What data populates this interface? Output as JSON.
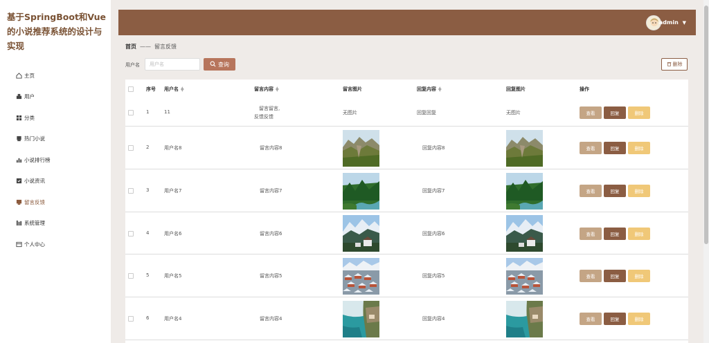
{
  "app": {
    "title": "基于SpringBoot和Vue的小说推荐系统的设计与实现"
  },
  "sidebar": {
    "items": [
      {
        "label": "主页",
        "icon": "home-icon"
      },
      {
        "label": "用户",
        "icon": "user-icon"
      },
      {
        "label": "分类",
        "icon": "grid-icon"
      },
      {
        "label": "热门小说",
        "icon": "book-icon"
      },
      {
        "label": "小说排行榜",
        "icon": "bar-chart-icon"
      },
      {
        "label": "小说资讯",
        "icon": "news-icon"
      },
      {
        "label": "留言反馈",
        "icon": "message-icon"
      },
      {
        "label": "系统管理",
        "icon": "settings-icon"
      },
      {
        "label": "个人中心",
        "icon": "profile-icon"
      }
    ]
  },
  "header": {
    "username": "admin"
  },
  "breadcrumb": {
    "home": "首页",
    "separator": "——",
    "current": "留言反馈"
  },
  "search": {
    "label": "用户名",
    "placeholder": "用户名",
    "button": "查询"
  },
  "toolbar": {
    "delete_label": "删除"
  },
  "table": {
    "columns": {
      "index": "序号",
      "username": "用户名",
      "content": "留言内容",
      "image": "留言图片",
      "reply": "回复内容",
      "reply_image": "回复图片",
      "actions": "操作"
    },
    "no_image": "无图片",
    "rows": [
      {
        "index": "1",
        "username": "11",
        "content": "留言留言,",
        "content2": "反馈反馈",
        "reply": "回复回复",
        "image": "none",
        "reply_image": "none"
      },
      {
        "index": "2",
        "username": "用户名8",
        "content": "留言内容8",
        "content2": "",
        "reply": "回复内容8",
        "image": "mountain-cliffs",
        "reply_image": "mountain-cliffs"
      },
      {
        "index": "3",
        "username": "用户名7",
        "content": "留言内容7",
        "content2": "",
        "reply": "回复内容7",
        "image": "forest-river",
        "reply_image": "forest-river"
      },
      {
        "index": "4",
        "username": "用户名6",
        "content": "留言内容6",
        "content2": "",
        "reply": "回复内容6",
        "image": "alpine-village",
        "reply_image": "alpine-village"
      },
      {
        "index": "5",
        "username": "用户名5",
        "content": "留言内容5",
        "content2": "",
        "reply": "回复内容5",
        "image": "snow-town",
        "reply_image": "snow-town"
      },
      {
        "index": "6",
        "username": "用户名4",
        "content": "留言内容4",
        "content2": "",
        "reply": "回复内容4",
        "image": "lake-cliff",
        "reply_image": "lake-cliff"
      }
    ],
    "actions": {
      "view": "查看",
      "reply": "回复",
      "delete": "删除"
    }
  },
  "colors": {
    "brand": "#8b5d43",
    "accent": "#b7755c",
    "view": "#c4a585",
    "delete": "#f0c878"
  }
}
